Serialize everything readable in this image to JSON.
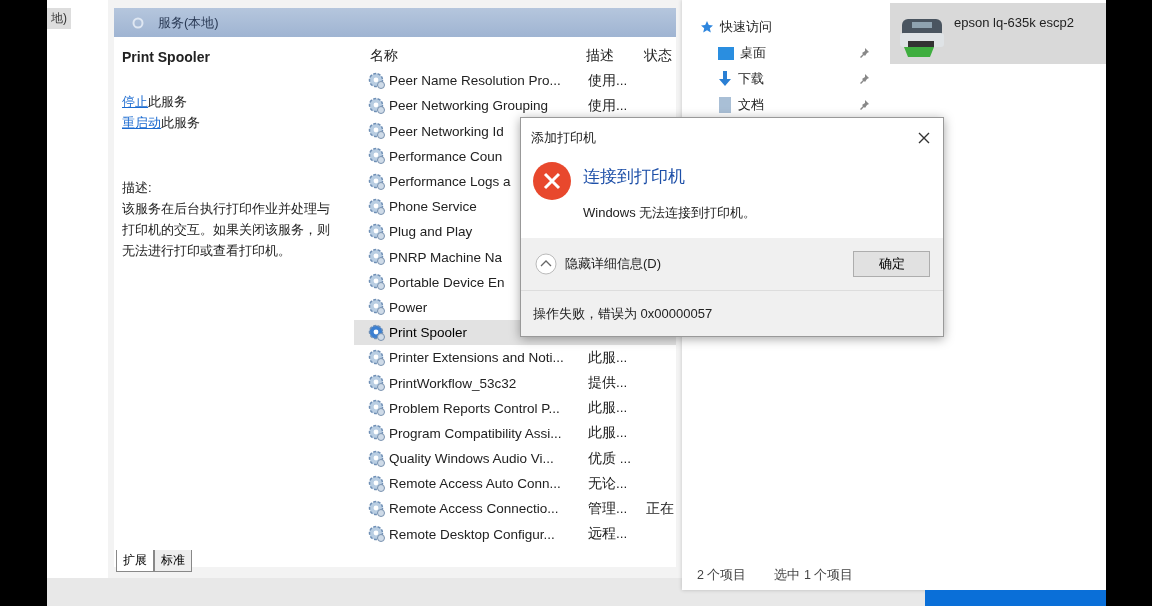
{
  "side_window": {
    "label": "地)"
  },
  "services": {
    "header": "服务(本地)",
    "detail": {
      "title": "Print Spooler",
      "actions": [
        {
          "link": "停止",
          "rest": "此服务"
        },
        {
          "link": "重启动",
          "rest": "此服务"
        }
      ],
      "description_label": "描述:",
      "description": "该服务在后台执行打印作业并处理与打印机的交互。如果关闭该服务，则无法进行打印或查看打印机。"
    },
    "columns": [
      "名称",
      "描述",
      "状态"
    ],
    "rows": [
      {
        "name": "Peer Name Resolution Pro...",
        "description": "使用...",
        "selected": false
      },
      {
        "name": "Peer Networking Grouping",
        "description": "使用...",
        "selected": false
      },
      {
        "name": "Peer Networking Id",
        "selected": false
      },
      {
        "name": "Performance Coun",
        "selected": false
      },
      {
        "name": "Performance Logs a",
        "selected": false
      },
      {
        "name": "Phone Service",
        "selected": false
      },
      {
        "name": "Plug and Play",
        "selected": false
      },
      {
        "name": "PNRP Machine Na",
        "selected": false
      },
      {
        "name": "Portable Device En",
        "selected": false
      },
      {
        "name": "Power",
        "selected": false
      },
      {
        "name": "Print Spooler",
        "selected": true
      },
      {
        "name": "Printer Extensions and Noti...",
        "description": "此服...",
        "selected": false
      },
      {
        "name": "PrintWorkflow_53c32",
        "description": "提供...",
        "selected": false
      },
      {
        "name": "Problem Reports Control P...",
        "description": "此服...",
        "selected": false
      },
      {
        "name": "Program Compatibility Assi...",
        "description": "此服...",
        "selected": false
      },
      {
        "name": "Quality Windows Audio Vi...",
        "description": "优质 ...",
        "selected": false
      },
      {
        "name": "Remote Access Auto Conn...",
        "description": "无论...",
        "selected": false
      },
      {
        "name": "Remote Access Connectio...",
        "description": "管理...",
        "status": "正在",
        "selected": false
      },
      {
        "name": "Remote Desktop Configur...",
        "description": "远程...",
        "selected": false
      }
    ],
    "tabs": [
      {
        "label": "扩展",
        "selected": true
      },
      {
        "label": "标准",
        "selected": false
      }
    ]
  },
  "explorer": {
    "nav": [
      {
        "label": "快速访问",
        "kind": "star",
        "pinned": false
      },
      {
        "label": "桌面",
        "kind": "desktop",
        "pinned": true
      },
      {
        "label": "下载",
        "kind": "download",
        "pinned": true
      },
      {
        "label": "文档",
        "kind": "document",
        "pinned": true
      }
    ],
    "files": [
      {
        "name": "epson lq-635k escp2",
        "selected": true
      }
    ],
    "status": [
      "2 个项目",
      "选中 1 个项目"
    ]
  },
  "dialog": {
    "title": "添加打印机",
    "heading": "连接到打印机",
    "message": "Windows 无法连接到打印机。",
    "details_toggle": "隐藏详细信息(D)",
    "expanded": true,
    "ok": "确定",
    "details": "操作失败，错误为 0x00000057"
  }
}
